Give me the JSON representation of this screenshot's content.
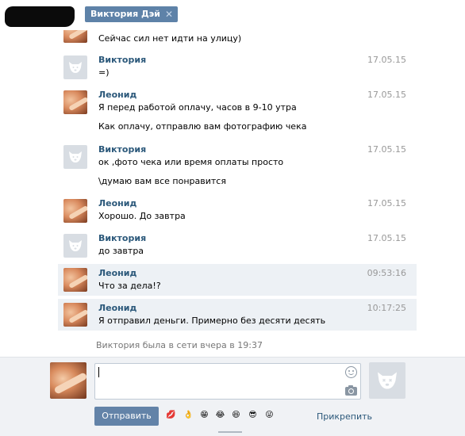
{
  "header": {
    "tab_title": "Виктория Дэй",
    "tab_close": "✕"
  },
  "history": {
    "messages": [
      {
        "author": "",
        "time": "",
        "lines": [
          "Сейчас сил нет идти на улицу)"
        ],
        "avatar": "leonid",
        "unread": false
      },
      {
        "author": "Виктория",
        "time": "17.05.15",
        "lines": [
          "=)"
        ],
        "avatar": "vika",
        "unread": false
      },
      {
        "author": "Леонид",
        "time": "17.05.15",
        "lines": [
          "Я перед работой оплачу, часов в 9-10 утра",
          "Как оплачу, отправлю вам фотографию чека"
        ],
        "avatar": "leonid",
        "unread": false
      },
      {
        "author": "Виктория",
        "time": "17.05.15",
        "lines": [
          "ок ,фото чека или время оплаты просто",
          "\\думаю вам все понравится"
        ],
        "avatar": "vika",
        "unread": false
      },
      {
        "author": "Леонид",
        "time": "17.05.15",
        "lines": [
          "Хорошо. До завтра"
        ],
        "avatar": "leonid",
        "unread": false
      },
      {
        "author": "Виктория",
        "time": "17.05.15",
        "lines": [
          "до завтра"
        ],
        "avatar": "vika",
        "unread": false
      },
      {
        "author": "Леонид",
        "time": "09:53:16",
        "lines": [
          "Что за дела!?"
        ],
        "avatar": "leonid",
        "unread": true
      },
      {
        "author": "Леонид",
        "time": "10:17:25",
        "lines": [
          "Я отправил деньги. Примерно без десяти десять"
        ],
        "avatar": "leonid",
        "unread": true
      }
    ],
    "last_seen": "Виктория была в сети вчера в 19:37"
  },
  "composer": {
    "input_value": "",
    "send_label": "Отправить",
    "attach_label": "Прикрепить",
    "emojis": [
      "💋",
      "👌",
      "😁",
      "😂",
      "😆",
      "😎",
      "😜"
    ]
  },
  "colors": {
    "accent": "#5e82a8",
    "link": "#2b587a",
    "unread_bg": "#edf1f5"
  }
}
